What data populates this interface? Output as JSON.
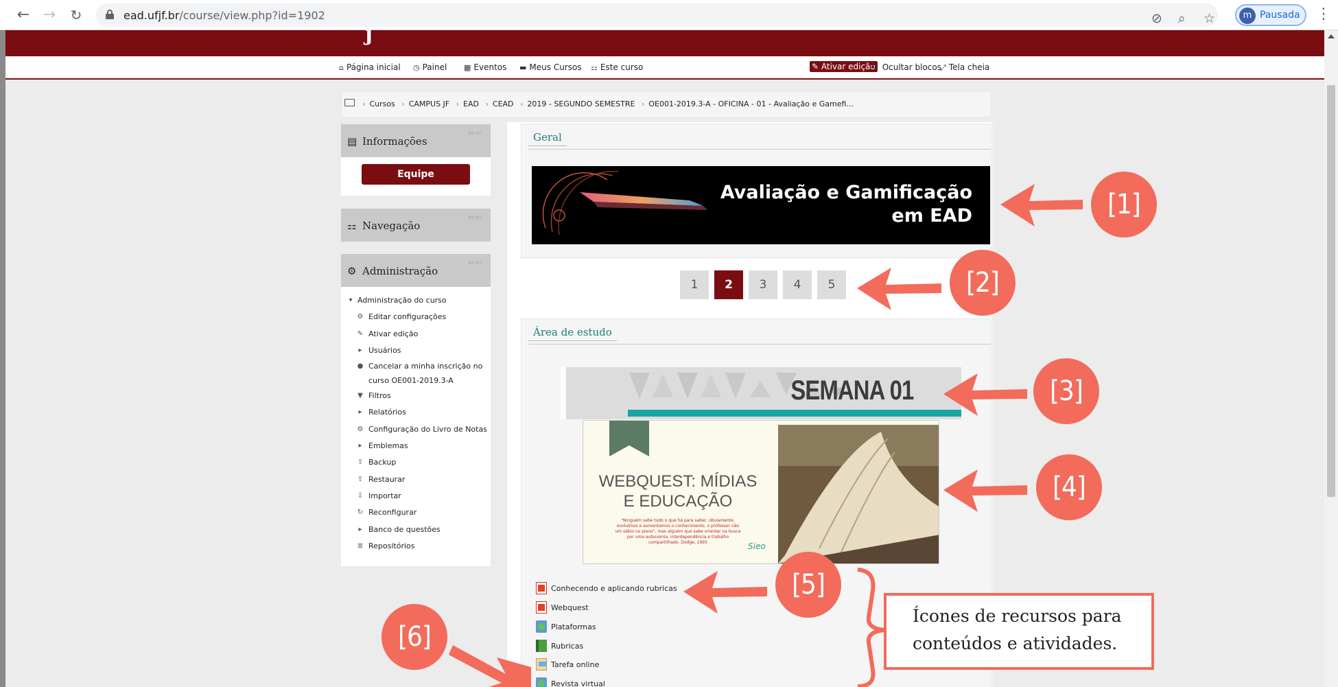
{
  "browser": {
    "url_host": "ead.ufjf.br",
    "url_path": "/course/view.php?id=1902",
    "profile_initial": "m",
    "profile_label": "Pausada"
  },
  "topnav": {
    "items": [
      {
        "label": "Página inicial",
        "icon": "home-icon"
      },
      {
        "label": "Painel",
        "icon": "dashboard-icon"
      },
      {
        "label": "Eventos",
        "icon": "calendar-icon"
      },
      {
        "label": "Meus Cursos",
        "icon": "briefcase-icon"
      },
      {
        "label": "Este curso",
        "icon": "sitemap-icon"
      }
    ],
    "edit_label": "Ativar edição",
    "hide_blocks_label": "Ocultar blocos",
    "fullscreen_label": "Tela cheia"
  },
  "breadcrumb": [
    "Cursos",
    "CAMPUS JF",
    "EAD",
    "CEAD",
    "2019 - SEGUNDO SEMESTRE",
    "OE001-2019.3-A - OFICINA - 01 - Avaliação e Gamefi..."
  ],
  "blocks": {
    "info": {
      "title": "Informações",
      "button": "Equipe"
    },
    "nav": {
      "title": "Navegação"
    },
    "admin": {
      "title": "Administração",
      "root": "Administração do curso",
      "items": [
        {
          "label": "Editar configurações",
          "icon": "gear-icon"
        },
        {
          "label": "Ativar edição",
          "icon": "pencil-icon"
        },
        {
          "label": "Usuários",
          "icon": "caret-right-icon"
        },
        {
          "label": "Cancelar a minha inscrição no curso OE001-2019.3-A",
          "icon": "user-icon"
        },
        {
          "label": "Filtros",
          "icon": "filter-icon"
        },
        {
          "label": "Relatórios",
          "icon": "caret-right-icon"
        },
        {
          "label": "Configuração do Livro de Notas",
          "icon": "gear-icon"
        },
        {
          "label": "Emblemas",
          "icon": "caret-right-icon"
        },
        {
          "label": "Backup",
          "icon": "upload-icon"
        },
        {
          "label": "Restaurar",
          "icon": "upload-icon"
        },
        {
          "label": "Importar",
          "icon": "download-icon"
        },
        {
          "label": "Reconfigurar",
          "icon": "refresh-icon"
        },
        {
          "label": "Banco de questões",
          "icon": "caret-right-icon"
        },
        {
          "label": "Repositórios",
          "icon": "database-icon"
        }
      ]
    }
  },
  "main": {
    "general_title": "Geral",
    "banner_line1": "Avaliação e Gamificação",
    "banner_line2": "em EAD",
    "pages": [
      "1",
      "2",
      "3",
      "4",
      "5"
    ],
    "active_page": "2",
    "study_title": "Área de estudo",
    "semana_label": "SEMANA 01",
    "webquest_title": "WEBQUEST: MÍDIAS E EDUCAÇÃO",
    "webquest_quote": "\"Ninguém sabe tudo o que há para saber, obviamente, evoluímos e aumentamos o conhecimento, o professor não um sábio no plano\", mas alguém que sabe orientar na busca por uma autonomia, interdependência e trabalho compartilhado. Dodge, 1995",
    "webquest_logo": "Sieo",
    "resources": [
      {
        "label": "Conhecendo e aplicando rubricas",
        "icon": "pdf-icon"
      },
      {
        "label": "Webquest",
        "icon": "pdf-icon"
      },
      {
        "label": "Plataformas",
        "icon": "url-icon"
      },
      {
        "label": "Rubricas",
        "icon": "book-icon"
      },
      {
        "label": "Tarefa online",
        "icon": "assignment-icon"
      },
      {
        "label": "Revista virtual",
        "icon": "url-icon"
      }
    ]
  },
  "annotations": {
    "badges": [
      "[1]",
      "[2]",
      "[3]",
      "[4]",
      "[5]",
      "[6]"
    ],
    "callout_text": "Ícones de recursos para conteúdos e atividades.",
    "color": "#f26b5b"
  },
  "colors": {
    "brand": "#7a0d12",
    "accent": "#1a7d7a",
    "annotation": "#f26b5b"
  }
}
